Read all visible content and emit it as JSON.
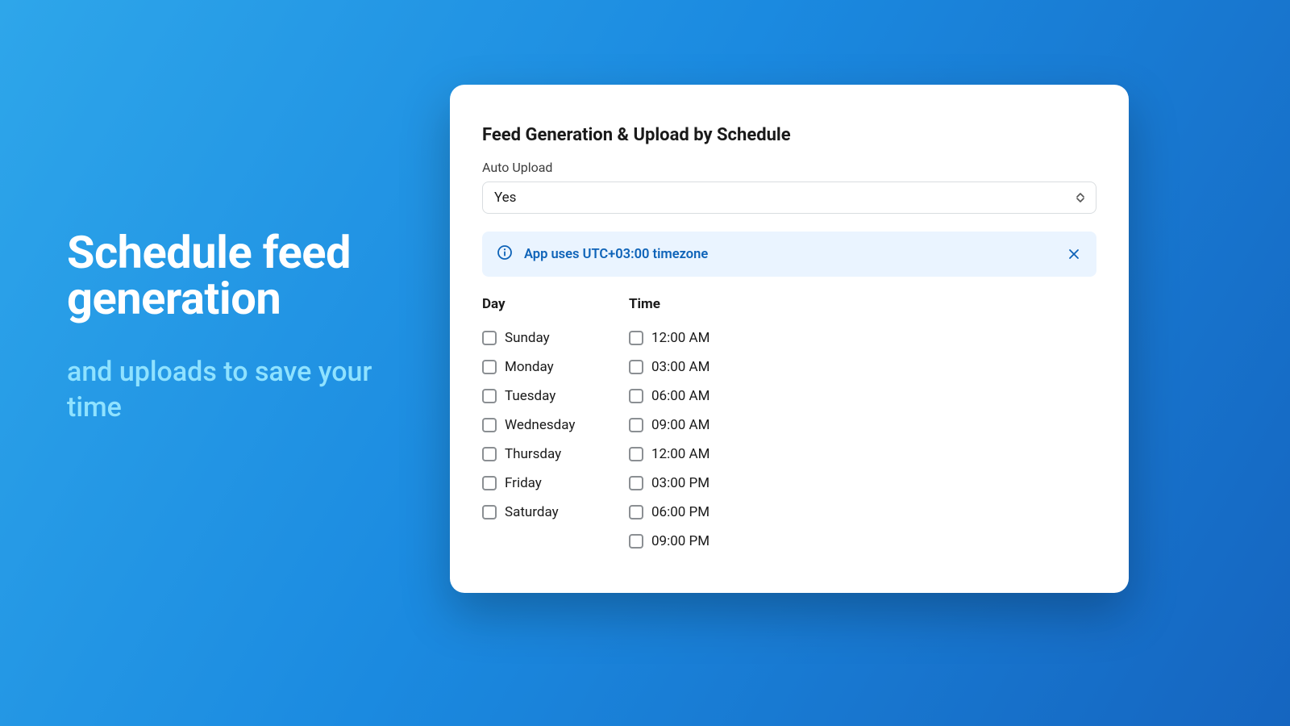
{
  "hero": {
    "title": "Schedule feed generation",
    "subtitle": "and uploads to save your time"
  },
  "card": {
    "title": "Feed Generation & Upload by Schedule",
    "auto_upload_label": "Auto Upload",
    "auto_upload_value": "Yes",
    "banner_text": "App uses UTC+03:00 timezone",
    "day_header": "Day",
    "time_header": "Time",
    "days": [
      "Sunday",
      "Monday",
      "Tuesday",
      "Wednesday",
      "Thursday",
      "Friday",
      "Saturday"
    ],
    "times": [
      "12:00 AM",
      "03:00 AM",
      "06:00 AM",
      "09:00 AM",
      "12:00 AM",
      "03:00 PM",
      "06:00 PM",
      "09:00 PM"
    ]
  }
}
